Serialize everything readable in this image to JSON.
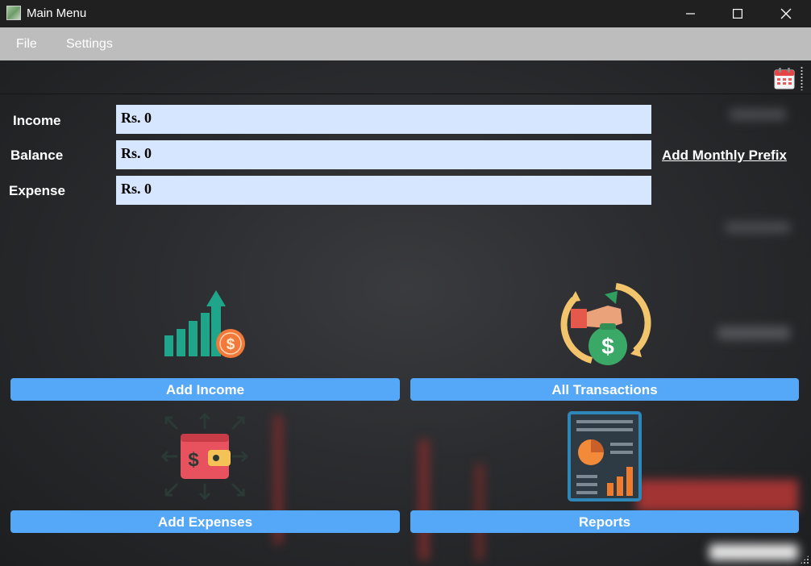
{
  "window": {
    "title": "Main Menu",
    "controls": [
      "minimize-icon",
      "maximize-icon",
      "close-icon"
    ]
  },
  "menu": {
    "file_label": "File",
    "settings_label": "Settings"
  },
  "toolbar": {
    "icon": "calendar-icon"
  },
  "summary": {
    "income_label": "Income",
    "income_value": "Rs. 0",
    "balance_label": "Balance",
    "balance_value": "Rs. 0",
    "expense_label": "Expense",
    "expense_value": "Rs. 0",
    "add_monthly_prefix_label": "Add Monthly Prefix"
  },
  "actions": {
    "add_income_label": "Add Income",
    "all_transactions_label": "All Transactions",
    "add_expenses_label": "Add Expenses",
    "reports_label": "Reports",
    "icons": [
      "income-growth-icon",
      "transactions-cycle-icon",
      "expenses-wallet-icon",
      "reports-document-icon"
    ]
  },
  "colors": {
    "button_blue": "#55a7f7",
    "field_background": "#d6e6ff",
    "menubar_gray": "#bdbdbd",
    "titlebar_dark": "#202020"
  }
}
